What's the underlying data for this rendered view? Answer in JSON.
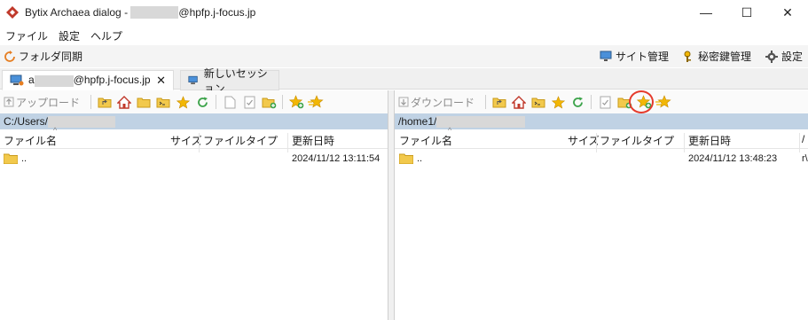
{
  "window": {
    "title_prefix": "Bytix Archaea dialog - ",
    "title_suffix": "@hpfp.j-focus.jp",
    "minimize": "—",
    "maximize": "☐",
    "close": "✕"
  },
  "menu": [
    "ファイル",
    "設定",
    "ヘルプ"
  ],
  "toolbar": {
    "sync_label": "フォルダ同期",
    "site_manager": "サイト管理",
    "key_manager": "秘密鍵管理",
    "settings": "設定"
  },
  "tabs": {
    "active_prefix": "a",
    "active_suffix": "@hpfp.j-focus.jp",
    "active_close": "✕",
    "new_session": "新しいセッション"
  },
  "left_pane": {
    "action_label": "アップロード",
    "path": "C:/Users/",
    "columns": [
      "ファイル名",
      "サイズ",
      "ファイルタイプ",
      "更新日時"
    ],
    "rows": [
      {
        "name": "..",
        "modified": "2024/11/12 13:11:54"
      }
    ]
  },
  "right_pane": {
    "action_label": "ダウンロード",
    "path": "/home1/",
    "columns": [
      "ファイル名",
      "サイズ",
      "ファイルタイプ",
      "更新日時",
      "/"
    ],
    "rows": [
      {
        "name": "..",
        "modified": "2024/11/12 13:48:23",
        "extra": "r\\"
      }
    ]
  },
  "colors": {
    "path_bar": "#c0d2e4",
    "highlight_ring": "#e53b2c",
    "folder": "#f2c94c",
    "refresh": "#3ca34a",
    "star": "#f2b705"
  }
}
